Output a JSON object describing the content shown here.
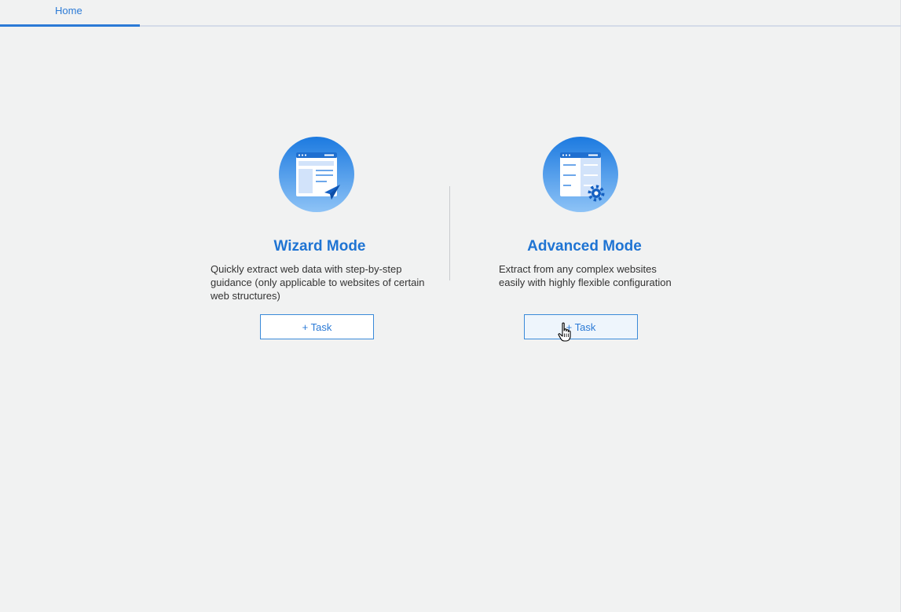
{
  "tabs": [
    {
      "label": "Home",
      "active": true
    }
  ],
  "modes": {
    "wizard": {
      "title": "Wizard Mode",
      "description_lines": [
        "Quickly extract web data with step-by-step",
        "guidance (only applicable to websites of certain",
        "web structures)"
      ],
      "button_label": "+ Task",
      "icon": "browser-window-paper-plane-icon"
    },
    "advanced": {
      "title": "Advanced Mode",
      "description_lines": [
        "Extract from any complex websites",
        "easily with highly flexible configuration"
      ],
      "button_label": "+ Task",
      "icon": "browser-window-gear-icon",
      "hovered": true
    }
  },
  "colors": {
    "accent": "#2b7ad6",
    "title_blue": "#1f74d3",
    "background": "#f1f2f2",
    "icon_gradient_top": "#1c7ae0",
    "icon_gradient_bottom": "#8ec3f6"
  }
}
